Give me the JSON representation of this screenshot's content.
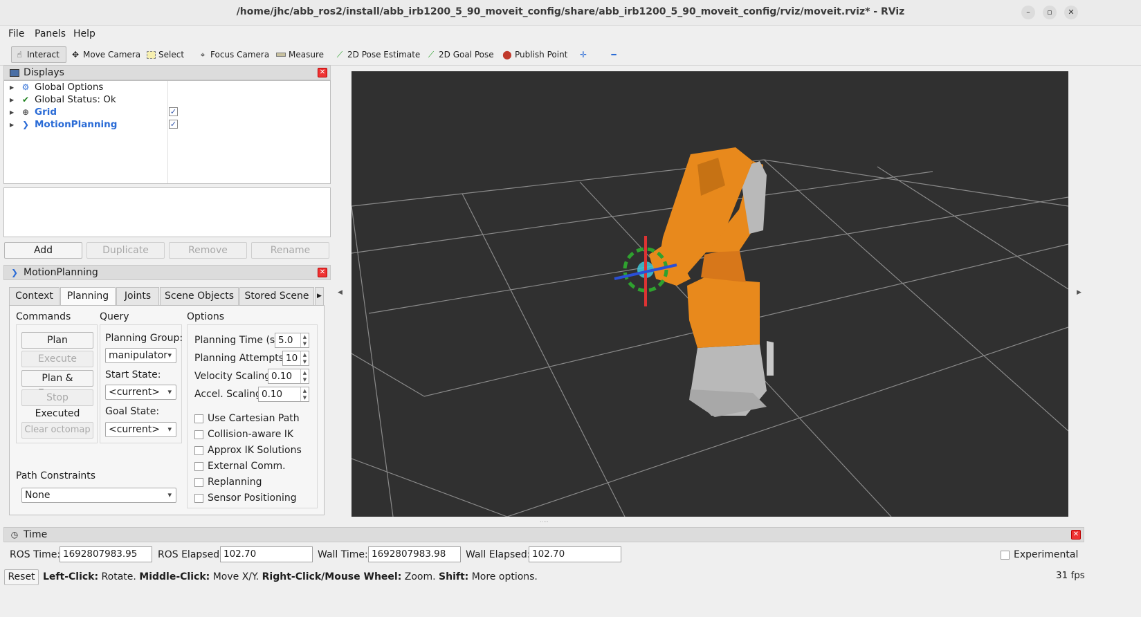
{
  "window": {
    "title": "/home/jhc/abb_ros2/install/abb_irb1200_5_90_moveit_config/share/abb_irb1200_5_90_moveit_config/rviz/moveit.rviz* - RViz",
    "min": "–",
    "max": "▫",
    "close": "✕"
  },
  "menu": {
    "file": "File",
    "panels": "Panels",
    "help": "Help"
  },
  "toolbar": {
    "interact": "Interact",
    "move_camera": "Move Camera",
    "select": "Select",
    "focus_camera": "Focus Camera",
    "measure": "Measure",
    "pose_estimate": "2D Pose Estimate",
    "goal_pose": "2D Goal Pose",
    "publish_point": "Publish Point",
    "plus": "✛",
    "minus": "━"
  },
  "displays": {
    "title": "Displays",
    "items": [
      {
        "label": "Global Options"
      },
      {
        "label": "Global Status: Ok"
      },
      {
        "label": "Grid",
        "checked": true
      },
      {
        "label": "MotionPlanning",
        "checked": true
      }
    ],
    "add": "Add",
    "duplicate": "Duplicate",
    "remove": "Remove",
    "rename": "Rename"
  },
  "motion": {
    "title": "MotionPlanning",
    "tabs": [
      "Context",
      "Planning",
      "Joints",
      "Scene Objects",
      "Stored Scene"
    ],
    "selected_tab": "Planning",
    "commands": {
      "title": "Commands",
      "plan": "Plan",
      "execute": "Execute",
      "plan_execute": "Plan & Execute",
      "stop": "Stop",
      "status": "Executed",
      "clear_octomap": "Clear octomap"
    },
    "query": {
      "title": "Query",
      "planning_group_label": "Planning Group:",
      "planning_group": "manipulator",
      "start_state_label": "Start State:",
      "start_state": "<current>",
      "goal_state_label": "Goal State:",
      "goal_state": "<current>"
    },
    "options": {
      "title": "Options",
      "planning_time_label": "Planning Time (s):",
      "planning_time": "5.0",
      "planning_attempts_label": "Planning Attempts:",
      "planning_attempts": "10",
      "velocity_label": "Velocity Scaling:",
      "velocity": "0.10",
      "accel_label": "Accel. Scaling:",
      "accel": "0.10",
      "checkboxes": [
        "Use Cartesian Path",
        "Collision-aware IK",
        "Approx IK Solutions",
        "External Comm.",
        "Replanning",
        "Sensor Positioning"
      ]
    },
    "path_constraints_label": "Path Constraints",
    "path_constraints": "None"
  },
  "time": {
    "title": "Time",
    "ros_time_label": "ROS Time:",
    "ros_time": "1692807983.95",
    "ros_elapsed_label": "ROS Elapsed:",
    "ros_elapsed": "102.70",
    "wall_time_label": "Wall Time:",
    "wall_time": "1692807983.98",
    "wall_elapsed_label": "Wall Elapsed:",
    "wall_elapsed": "102.70",
    "experimental": "Experimental"
  },
  "status": {
    "reset": "Reset",
    "left": "Left-Click:",
    "left_t": " Rotate. ",
    "middle": "Middle-Click:",
    "middle_t": " Move X/Y. ",
    "right": "Right-Click/Mouse Wheel:",
    "right_t": " Zoom. ",
    "shift": "Shift:",
    "shift_t": " More options.",
    "fps": "31 fps"
  },
  "colors": {
    "robot_orange": "#e8891c",
    "robot_gray": "#b9b9b9",
    "viewport": "#303030",
    "grid": "#8a8a8a"
  }
}
